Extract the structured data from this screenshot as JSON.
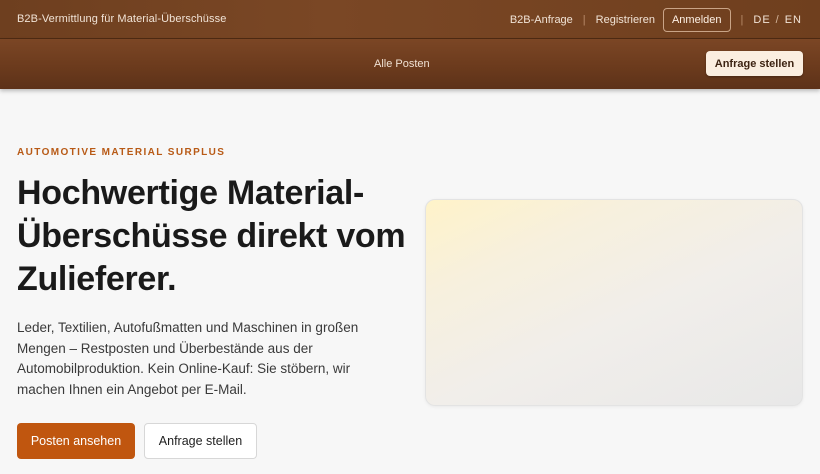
{
  "header": {
    "tagline": "B2B-Vermittlung für Material-Überschüsse",
    "nav": {
      "b2b_request": "B2B-Anfrage",
      "register": "Registrieren",
      "login": "Anmelden",
      "lang_de": "DE",
      "lang_sep": "/",
      "lang_en": "EN"
    }
  },
  "subnav": {
    "all_posts": "Alle Posten",
    "cta": "Anfrage stellen"
  },
  "hero": {
    "eyebrow": "AUTOMOTIVE MATERIAL SURPLUS",
    "headline": "Hochwertige Material-Überschüsse direkt vom Zulieferer.",
    "lead": "Leder, Textilien, Autofußmatten und Maschinen in großen Mengen – Restposten und Überbestände aus der Automobilproduktion. Kein Online-Kauf: Sie stöbern, wir machen Ihnen ein Angebot per E-Mail.",
    "primary_button": "Posten ansehen",
    "secondary_button": "Anfrage stellen"
  },
  "colors": {
    "brand_brown": "#6e3f1f",
    "accent_orange": "#c0560f",
    "cream": "#fbeee0"
  }
}
